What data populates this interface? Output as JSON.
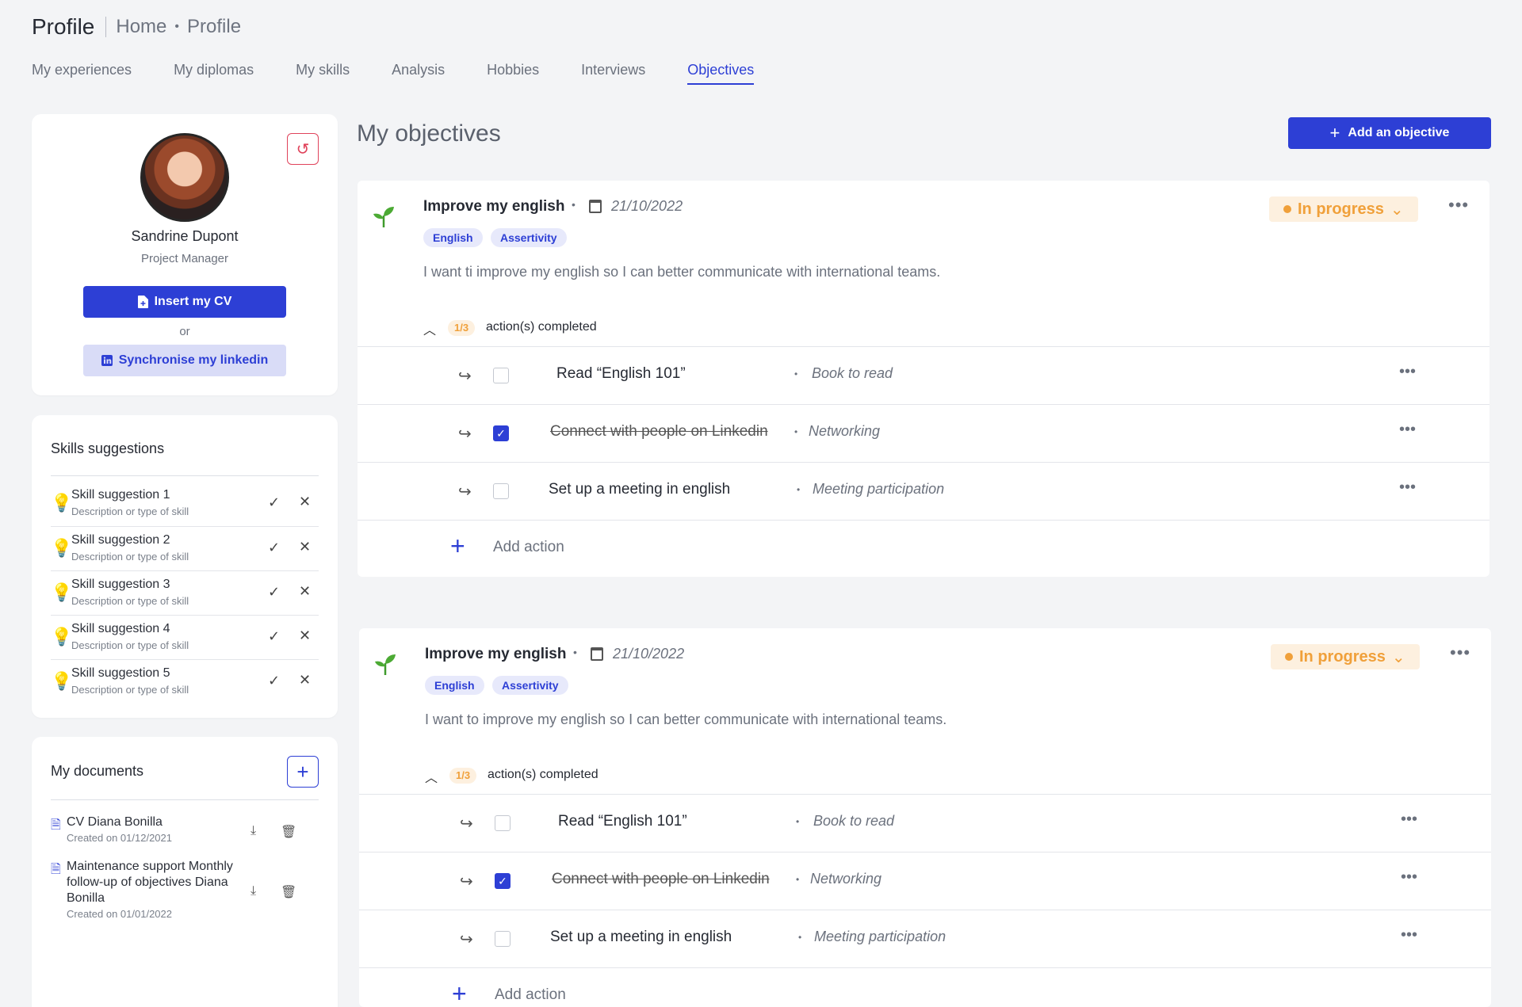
{
  "header": {
    "title": "Profile",
    "breadcrumb": [
      "Home",
      "Profile"
    ]
  },
  "tabs": [
    {
      "label": "My experiences",
      "active": false
    },
    {
      "label": "My diplomas",
      "active": false
    },
    {
      "label": "My skills",
      "active": false
    },
    {
      "label": "Analysis",
      "active": false
    },
    {
      "label": "Hobbies",
      "active": false
    },
    {
      "label": "Interviews",
      "active": false
    },
    {
      "label": "Objectives",
      "active": true
    }
  ],
  "profile": {
    "name": "Sandrine Dupont",
    "role": "Project Manager",
    "insert_cv_label": "Insert my CV",
    "or_label": "or",
    "linkedin_label": "Synchronise my linkedin"
  },
  "skills": {
    "title": "Skills suggestions",
    "items": [
      {
        "name": "Skill suggestion 1",
        "desc": "Description or type of skill"
      },
      {
        "name": "Skill suggestion 2",
        "desc": "Description or type of skill"
      },
      {
        "name": "Skill suggestion 3",
        "desc": "Description or type of skill"
      },
      {
        "name": "Skill suggestion 4",
        "desc": "Description or type of skill"
      },
      {
        "name": "Skill suggestion 5",
        "desc": "Description or type of skill"
      }
    ]
  },
  "documents": {
    "title": "My documents",
    "items": [
      {
        "name": "CV Diana Bonilla",
        "date": "Created on 01/12/2021"
      },
      {
        "name": "Maintenance support Monthly follow-up of objectives Diana Bonilla",
        "date": "Created on 01/01/2022"
      }
    ]
  },
  "main": {
    "title": "My objectives",
    "add_label": "Add an objective"
  },
  "objectives": [
    {
      "title": "Improve my english",
      "date": "21/10/2022",
      "tags": [
        "English",
        "Assertivity"
      ],
      "description": "I want ti improve my english so I can better communicate with international teams.",
      "status": "In progress",
      "count": "1/3",
      "completed_label": "action(s) completed",
      "actions": [
        {
          "name": "Read “English 101”",
          "type": "Book to read",
          "done": false
        },
        {
          "name": "Connect with people on Linkedin",
          "type": "Networking",
          "done": true
        },
        {
          "name": "Set up a meeting in english",
          "type": "Meeting participation",
          "done": false
        }
      ],
      "add_action_label": "Add action"
    },
    {
      "title": "Improve my english",
      "date": "21/10/2022",
      "tags": [
        "English",
        "Assertivity"
      ],
      "description": "I want to improve my english so I can better communicate with international teams.",
      "status": "In progress",
      "count": "1/3",
      "completed_label": "action(s) completed",
      "actions": [
        {
          "name": "Read “English 101”",
          "type": "Book to read",
          "done": false
        },
        {
          "name": "Connect with people on Linkedin",
          "type": "Networking",
          "done": true
        },
        {
          "name": "Set up a meeting in english",
          "type": "Meeting participation",
          "done": false
        }
      ],
      "add_action_label": "Add action"
    }
  ],
  "colors": {
    "accent": "#2d3fd5",
    "status": "#f0a03a",
    "danger": "#e0435b"
  }
}
